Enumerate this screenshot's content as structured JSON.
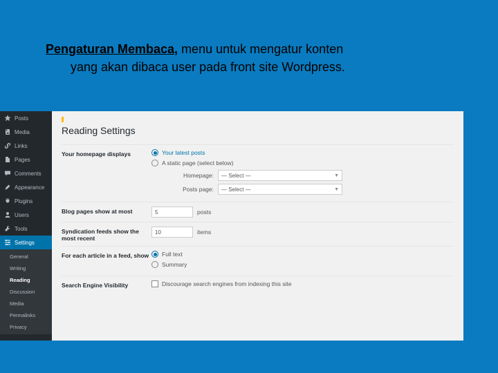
{
  "slide": {
    "title_bold": "Pengaturan Membaca,",
    "title_rest": " menu untuk mengatur konten",
    "title_line2": "yang akan dibaca user pada front site Wordpress."
  },
  "sidebar": {
    "items": [
      {
        "icon": "pin",
        "label": "Posts"
      },
      {
        "icon": "media",
        "label": "Media"
      },
      {
        "icon": "link",
        "label": "Links"
      },
      {
        "icon": "page",
        "label": "Pages"
      },
      {
        "icon": "comment",
        "label": "Comments"
      },
      {
        "icon": "appearance",
        "label": "Appearance"
      },
      {
        "icon": "plugin",
        "label": "Plugins"
      },
      {
        "icon": "user",
        "label": "Users"
      },
      {
        "icon": "tool",
        "label": "Tools"
      },
      {
        "icon": "settings",
        "label": "Settings",
        "current": true
      }
    ],
    "submenu": [
      {
        "label": "General"
      },
      {
        "label": "Writing"
      },
      {
        "label": "Reading",
        "current": true
      },
      {
        "label": "Discussion"
      },
      {
        "label": "Media"
      },
      {
        "label": "Permalinks"
      },
      {
        "label": "Privacy"
      }
    ]
  },
  "content": {
    "heading": "Reading Settings",
    "rows": {
      "homepage_label": "Your homepage displays",
      "homepage_opt1": "Your latest posts",
      "homepage_opt2": "A static page (select below)",
      "homepage_sel_label1": "Homepage:",
      "homepage_sel_label2": "Posts page:",
      "homepage_select_placeholder": "— Select —",
      "blog_pages_label": "Blog pages show at most",
      "blog_pages_value": "5",
      "blog_pages_unit": "posts",
      "syndication_label": "Syndication feeds show the most recent",
      "syndication_value": "10",
      "syndication_unit": "items",
      "article_label": "For each article in a feed, show",
      "article_opt1": "Full text",
      "article_opt2": "Summary",
      "sev_label": "Search Engine Visibility",
      "sev_check": "Discourage search engines from indexing this site"
    }
  }
}
